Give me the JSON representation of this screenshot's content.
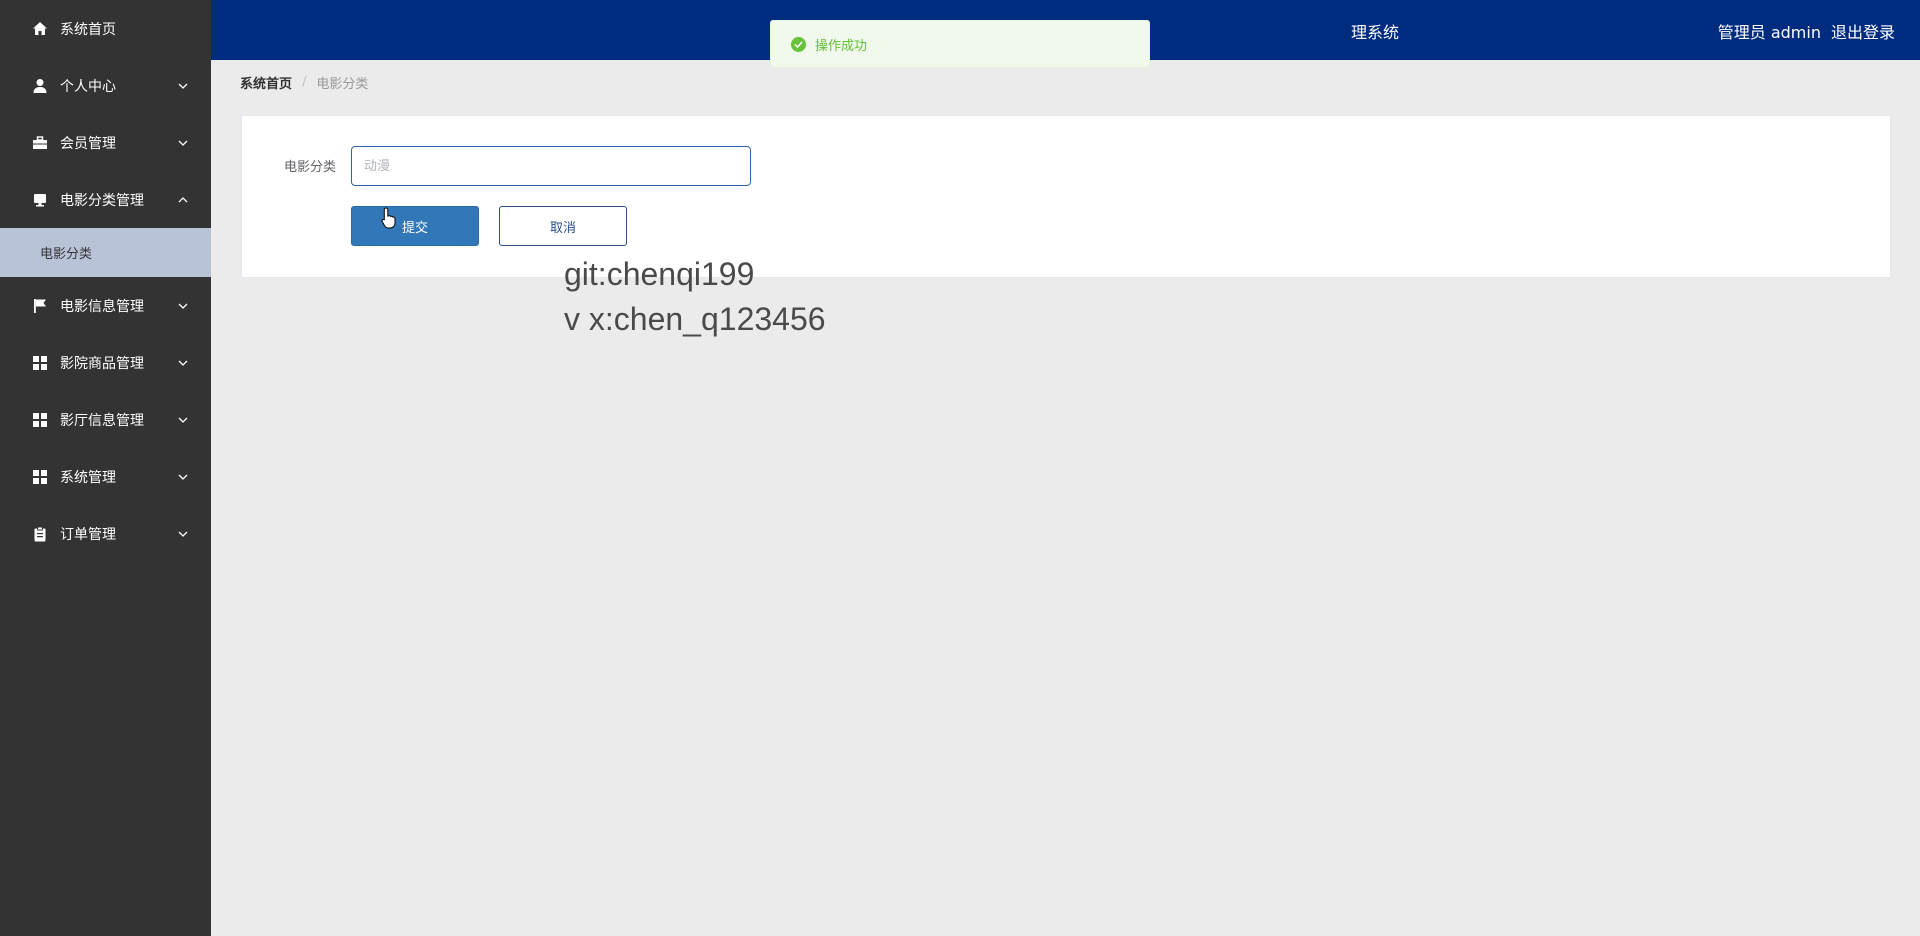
{
  "sidebar": {
    "items": [
      {
        "label": "系统首页",
        "icon": "home-icon",
        "chevron": ""
      },
      {
        "label": "个人中心",
        "icon": "user-icon",
        "chevron": "down"
      },
      {
        "label": "会员管理",
        "icon": "briefcase-icon",
        "chevron": "down"
      },
      {
        "label": "电影分类管理",
        "icon": "monitor-icon",
        "chevron": "up"
      },
      {
        "label": "电影信息管理",
        "icon": "flag-icon",
        "chevron": "down"
      },
      {
        "label": "影院商品管理",
        "icon": "grid-icon",
        "chevron": "down"
      },
      {
        "label": "影厅信息管理",
        "icon": "grid-icon",
        "chevron": "down"
      },
      {
        "label": "系统管理",
        "icon": "grid-icon",
        "chevron": "down"
      },
      {
        "label": "订单管理",
        "icon": "clipboard-icon",
        "chevron": "down"
      }
    ],
    "submenu": {
      "label": "电影分类"
    }
  },
  "header": {
    "title": "理系统",
    "user_label": "管理员 admin",
    "logout_label": "退出登录"
  },
  "toast": {
    "message": "操作成功",
    "icon": "success-check-icon"
  },
  "breadcrumb": {
    "home": "系统首页",
    "separator": "/",
    "current": "电影分类"
  },
  "form": {
    "label": "电影分类",
    "input_value": "",
    "input_placeholder": "动漫",
    "submit_label": "提交",
    "cancel_label": "取消"
  },
  "watermark": {
    "line1": "git:chenqi199",
    "line2": "v x:chen_q123456"
  },
  "colors": {
    "sidebar_bg": "#333333",
    "header_bg": "#002c80",
    "submenu_active_bg": "#b9c3d8",
    "submit_bg": "#3278b8",
    "toast_text": "#67c23a"
  }
}
